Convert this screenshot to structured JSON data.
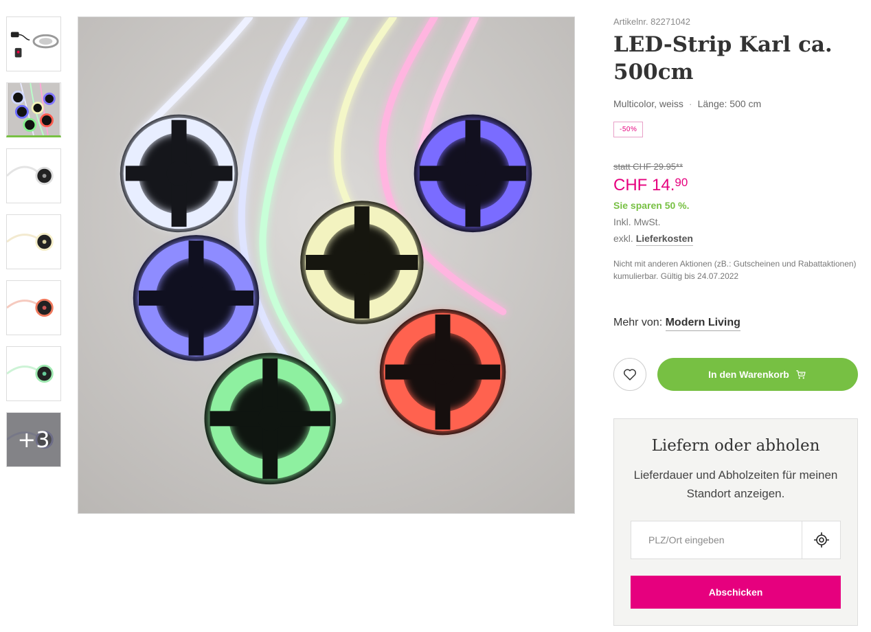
{
  "product": {
    "article_number": "Artikelnr. 82271042",
    "title_bold": "LED-Strip",
    "title_rest": " Karl ca. 500cm",
    "color": "Multicolor, weiss",
    "separator": "·",
    "length": "Länge: 500 cm",
    "discount_badge": "-50%",
    "old_price": "statt CHF 29.95**",
    "price_main": "CHF 14.",
    "price_cents": "90",
    "savings": "Sie sparen 50 %.",
    "vat": "Inkl. MwSt.",
    "shipping_prefix": "exkl. ",
    "shipping_link": "Lieferkosten",
    "note": "Nicht mit anderen Aktionen (zB.: Gutscheinen und Rabattak­tionen) kumulierbar. Gültig bis 24.07.2022",
    "brand_prefix": "Mehr von: ",
    "brand_link": "Modern Living"
  },
  "actions": {
    "wishlist_icon": "heart-icon",
    "cart_label": "In den Warenkorb",
    "cart_icon": "cart-icon"
  },
  "gallery": {
    "thumbnails": [
      "LED strip with remote and power supply",
      "Multicolor LED reels",
      "White LED strip reel",
      "Warm white LED reel",
      "Red LED reel",
      "Green LED reel",
      "Blue LED reel"
    ],
    "active_index": 1,
    "more_count": "+3"
  },
  "delivery": {
    "heading": "Liefern oder abholen",
    "text": "Lieferdauer und Abholzeiten für meinen Standort anzeigen.",
    "input_placeholder": "PLZ/Ort eingeben",
    "locate_icon": "location-target-icon",
    "submit_label": "Abschicken"
  },
  "colors": {
    "accent_pink": "#e6007e",
    "accent_green": "#77c043"
  }
}
